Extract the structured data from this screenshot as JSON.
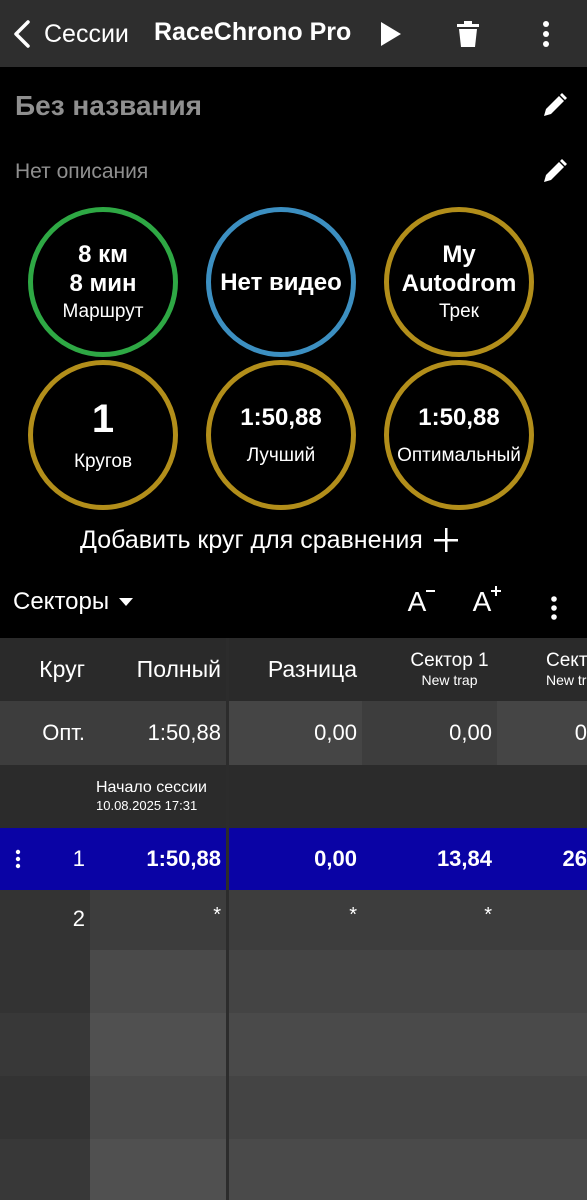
{
  "topbar": {
    "back_label": "Сессии",
    "title": "RaceChrono Pro",
    "icons": [
      "chevron-left-icon",
      "play-icon",
      "trash-icon",
      "more-vertical-icon"
    ]
  },
  "session": {
    "name": "Без названия",
    "description": "Нет описания"
  },
  "circles": [
    {
      "line1": "8 км",
      "line2": "8 мин",
      "label": "Маршрут",
      "color": "#2ea844"
    },
    {
      "line1": "Нет видео",
      "color": "#3c8fc1"
    },
    {
      "line1": "My",
      "line2": "Autodrom",
      "label": "Трек",
      "color": "#b28e1a"
    },
    {
      "value": "1",
      "label": "Кругов",
      "color": "#b28e1a"
    },
    {
      "value": "1:50,88",
      "label": "Лучший",
      "color": "#b28e1a"
    },
    {
      "value": "1:50,88",
      "label": "Оптимальный",
      "color": "#b28e1a"
    }
  ],
  "add_lap": "Добавить круг для сравнения",
  "toolbar": {
    "view": "Секторы",
    "font_decrease": "A",
    "font_increase": "A"
  },
  "table": {
    "headers": {
      "lap": "Круг",
      "full": "Полный",
      "diff": "Разница",
      "sector1_title": "Сектор 1",
      "sector1_sub": "New trap",
      "sector2_title": "Сект",
      "sector2_sub": "New tr"
    },
    "optimal": {
      "lap": "Опт.",
      "full": "1:50,88",
      "diff": "0,00",
      "s1": "0,00",
      "s2": "0"
    },
    "session_start": {
      "title": "Начало сессии",
      "datetime": "10.08.2025 17:31"
    },
    "laps": [
      {
        "lap": "1",
        "full": "1:50,88",
        "diff": "0,00",
        "s1": "13,84",
        "s2": "26"
      },
      {
        "lap": "2",
        "full": "*",
        "diff": "*",
        "s1": "*",
        "s2": ""
      }
    ]
  },
  "colors": {
    "highlight_row": "#0a03a5",
    "route": "#2ea844",
    "video": "#3c8fc1",
    "stats": "#b28e1a"
  }
}
